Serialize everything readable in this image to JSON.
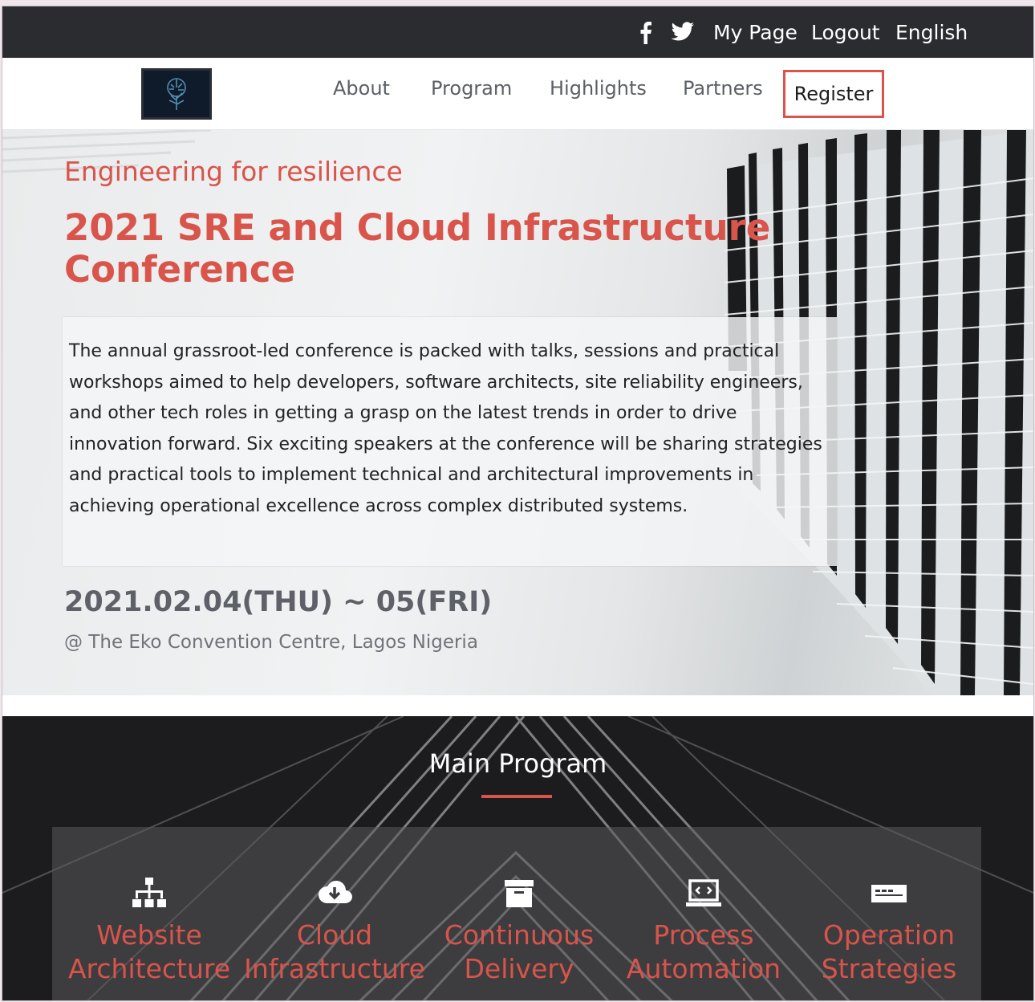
{
  "topbar": {
    "icons": [
      "facebook-icon",
      "twitter-icon"
    ],
    "links": {
      "mypage": "My Page",
      "logout": "Logout",
      "language": "English"
    }
  },
  "navbar": {
    "logo": "tree-logo",
    "items": {
      "about": "About",
      "program": "Program",
      "highlights": "Highlights",
      "partners": "Partners"
    },
    "register": "Register"
  },
  "hero": {
    "tagline": "Engineering for resilience",
    "title": "2021 SRE and Cloud Infrastructure Conference",
    "description": "The annual grassroot-led conference is packed with talks, sessions and practical workshops aimed to help developers, software architects, site reliability engineers, and other tech roles in getting a grasp on the latest trends in order to drive innovation forward. Six exciting speakers at the conference will be sharing strategies and practical tools to implement technical and architectural improvements in achieving operational excellence across complex distributed systems.",
    "date": "2021.02.04(THU) ~ 05(FRI)",
    "venue": "@ The Eko Convention Centre, Lagos Nigeria"
  },
  "program": {
    "title": "Main Program",
    "cards": [
      {
        "label": "Website Architecture",
        "icon": "sitemap-icon"
      },
      {
        "label": "Cloud Infrastructure",
        "icon": "cloud-download-icon"
      },
      {
        "label": "Continuous Delivery",
        "icon": "archive-box-icon"
      },
      {
        "label": "Process Automation",
        "icon": "laptop-code-icon"
      },
      {
        "label": "Operation Strategies",
        "icon": "server-icon"
      }
    ]
  },
  "colors": {
    "accent": "#d9544a",
    "topbar": "#2b2c30",
    "nav_text": "#5c6066"
  }
}
